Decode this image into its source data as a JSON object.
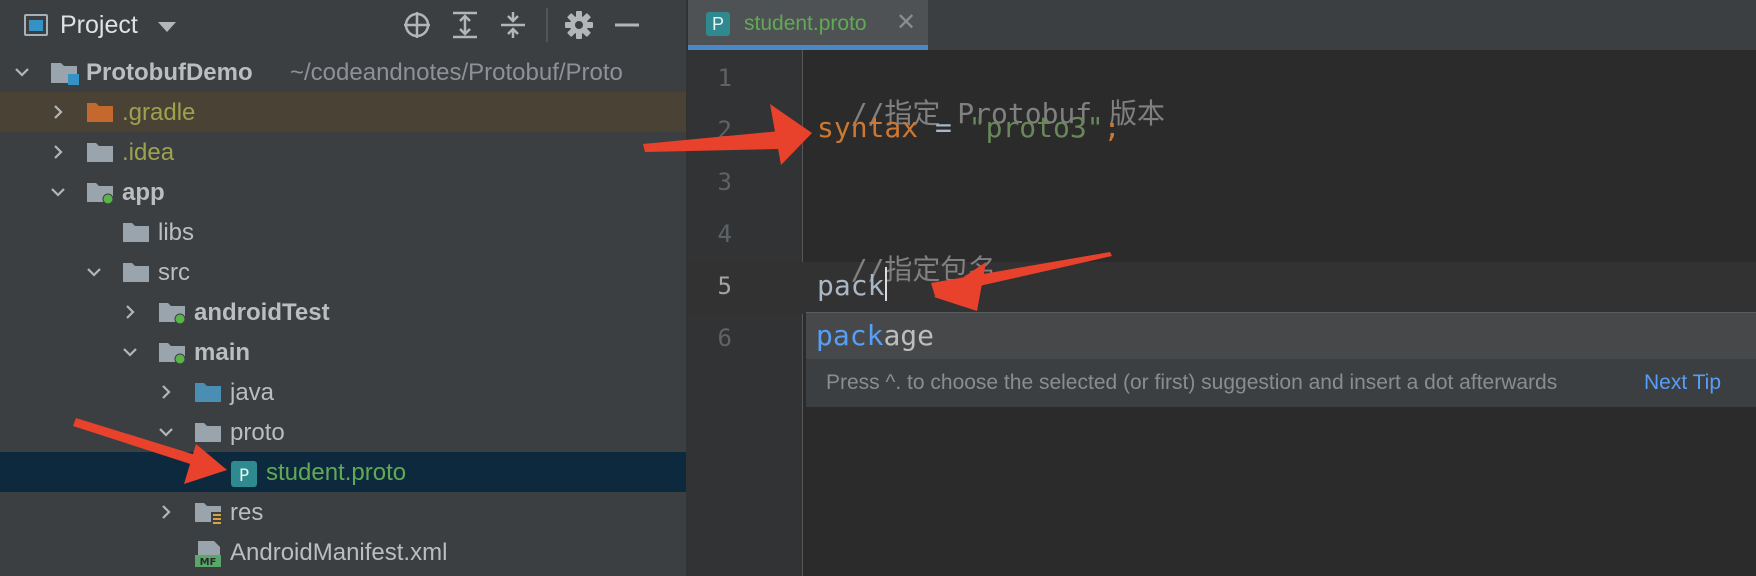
{
  "project_panel": {
    "title": "Project",
    "toolbar_icons": [
      "locate-icon",
      "expand-all-icon",
      "collapse-all-icon",
      "gear-icon",
      "minimize-icon"
    ],
    "tree": [
      {
        "label": "ProtobufDemo",
        "path": "~/codeandnotes/Protobuf/Proto",
        "expanded": true
      },
      {
        "label": ".gradle",
        "expanded": false
      },
      {
        "label": ".idea",
        "expanded": false
      },
      {
        "label": "app",
        "expanded": true
      },
      {
        "label": "libs"
      },
      {
        "label": "src",
        "expanded": true
      },
      {
        "label": "androidTest",
        "expanded": false
      },
      {
        "label": "main",
        "expanded": true
      },
      {
        "label": "java",
        "expanded": false
      },
      {
        "label": "proto",
        "expanded": true
      },
      {
        "label": "student.proto",
        "selected": true,
        "file_badge": "P"
      },
      {
        "label": "res",
        "expanded": false
      },
      {
        "label": "AndroidManifest.xml",
        "file_badge": "MF"
      }
    ]
  },
  "editor": {
    "tab": {
      "label": "student.proto",
      "badge": "P",
      "close": "✕"
    },
    "line_numbers": [
      "1",
      "2",
      "3",
      "4",
      "5",
      "6"
    ],
    "current_line": "5",
    "lines": {
      "l1": "//指定 Protobuf 版本",
      "l2_keyword": "syntax",
      "l2_op": " = ",
      "l2_string": "\"proto3\"",
      "l2_semi": ";",
      "l4": "//指定包名",
      "l5": "pack"
    },
    "completion": {
      "match": "pack",
      "rest": "age",
      "tip": "Press ^. to choose the selected (or first) suggestion and insert a dot afterwards",
      "next_tip": "Next Tip"
    }
  },
  "colors": {
    "panel_bg": "#3c3f41",
    "editor_bg": "#2b2b2b",
    "selection": "#0d293e",
    "keyword": "#cc7832",
    "string": "#6a8759",
    "comment": "#808080",
    "annotation_arrow": "#e8412c"
  }
}
